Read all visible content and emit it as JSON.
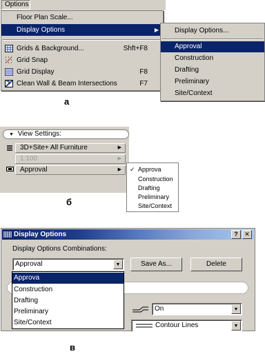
{
  "panel_a": {
    "menubar_label": "Options",
    "menu_items": [
      {
        "label": "Floor Plan Scale...",
        "shortcut": "",
        "icon": "",
        "submenu": false,
        "selected": false
      },
      {
        "label": "Display Options",
        "shortcut": "",
        "icon": "",
        "submenu": true,
        "selected": true
      },
      {
        "label": "Grids & Background...",
        "shortcut": "Shft+F8",
        "icon": "grid-background-icon",
        "submenu": false,
        "selected": false
      },
      {
        "label": "Grid Snap",
        "shortcut": "",
        "icon": "grid-snap-icon",
        "submenu": false,
        "selected": false
      },
      {
        "label": "Grid Display",
        "shortcut": "F8",
        "icon": "grid-display-icon",
        "submenu": false,
        "selected": false
      },
      {
        "label": "Clean Wall & Beam Intersections",
        "shortcut": "F7",
        "icon": "clean-intersections-icon",
        "submenu": false,
        "selected": false
      }
    ],
    "submenu_header": "Display Options...",
    "submenu_items": [
      "Approval",
      "Construction",
      "Drafting",
      "Preliminary",
      "Site/Context"
    ],
    "submenu_selected": "Approval",
    "caption": "a"
  },
  "panel_b": {
    "header": "View Settings:",
    "rows": [
      {
        "label": "3D+Site+ All Furniture",
        "icon": "layers-icon",
        "disabled": false
      },
      {
        "label": "1:100",
        "icon": "",
        "disabled": true
      },
      {
        "label": "Approval",
        "icon": "display-options-icon",
        "disabled": false
      }
    ],
    "popup_items": [
      "Approva",
      "Construction",
      "Drafting",
      "Preliminary",
      "Site/Context"
    ],
    "popup_checked": "Approva",
    "caption": "б"
  },
  "panel_c": {
    "title": "Display Options",
    "help_button": "?",
    "close_button": "✕",
    "combinations_label": "Display Options Combinations:",
    "combo_value": "Approval",
    "save_as_label": "Save As...",
    "delete_label": "Delete",
    "dropdown_items": [
      "Approva",
      "Construction",
      "Drafting",
      "Preliminary",
      "Site/Context"
    ],
    "dropdown_selected": "Approva",
    "on_value": "On",
    "contour_value": "Contour Lines",
    "caption": "в"
  }
}
